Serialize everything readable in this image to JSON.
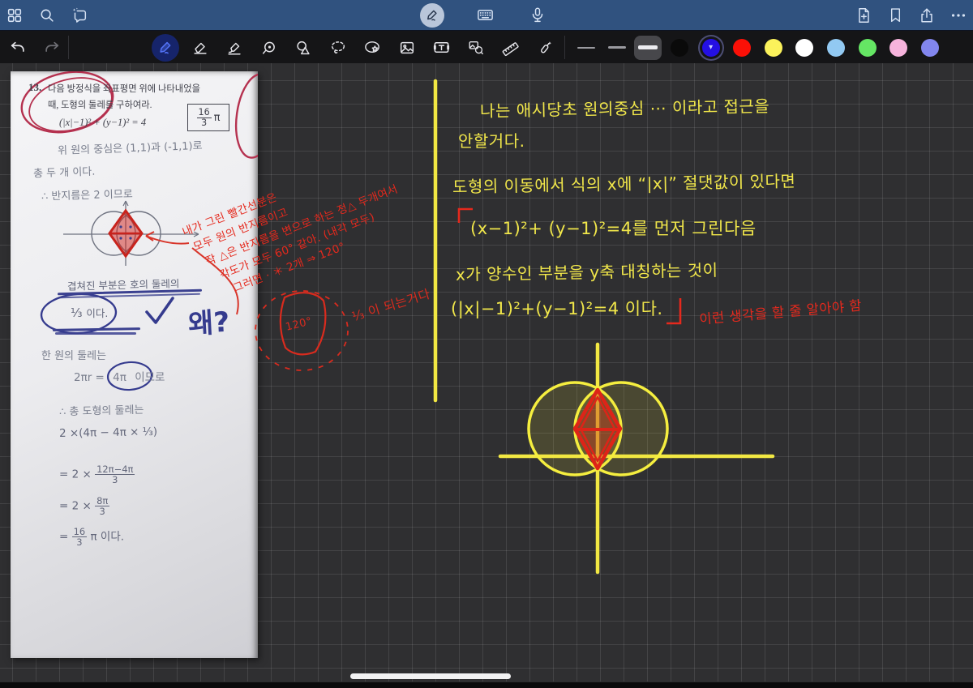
{
  "topbar": {
    "left_icons": [
      "apps-grid",
      "search",
      "sparkle-chat"
    ],
    "center_icons": [
      "pen-mode",
      "keyboard",
      "microphone"
    ],
    "right_icons": [
      "add-page",
      "bookmark",
      "share",
      "more"
    ]
  },
  "toolbar": {
    "tools": [
      "undo",
      "redo",
      "pen",
      "eraser",
      "highlighter",
      "loupe",
      "shapes",
      "lasso",
      "sticker",
      "image",
      "text",
      "photo-search",
      "ruler",
      "laser"
    ],
    "selected_tool": "pen",
    "stroke_widths": [
      "thin",
      "medium",
      "thick"
    ],
    "selected_stroke": "thick",
    "colors": [
      {
        "name": "black",
        "hex": "#0a0a0a",
        "css": "background:#0a0a0a"
      },
      {
        "name": "blue",
        "hex": "#2410e3",
        "css": "background:#2410e3",
        "selected": true
      },
      {
        "name": "red",
        "hex": "#fb1007",
        "css": "background:#fb1007"
      },
      {
        "name": "yellow",
        "hex": "#fbf25b",
        "css": "background:#fbf25b"
      },
      {
        "name": "white",
        "hex": "#ffffff",
        "css": "background:#ffffff"
      },
      {
        "name": "sky-blue",
        "hex": "#92c9f2",
        "css": "background:#92c9f2"
      },
      {
        "name": "green",
        "hex": "#65e664",
        "css": "background:#65e664"
      },
      {
        "name": "pink",
        "hex": "#f6b3dc",
        "css": "background:#f6b3dc"
      },
      {
        "name": "periwinkle",
        "hex": "#8286ee",
        "css": "background:#8286ee"
      }
    ]
  },
  "paper": {
    "problem_number": "13.",
    "problem_line1": "다음 방정식을 좌표평면 위에 나타내었을",
    "problem_line2": "때, 도형의 둘레를 구하여라.",
    "formula": "(|x|−1)² + (y−1)² = 4",
    "answer_numerator": "16",
    "answer_denominator": "3",
    "answer_pi": "π",
    "pencil_line1": "위 원의 중심은 (1,1)과 (-1,1)로",
    "pencil_line2": "총 두 개 이다.",
    "pencil_line3": "∴ 반지름은 2 이므로",
    "covered_line": "겹쳐진 부분은 호의 둘레의",
    "third_label": "⅓",
    "third_suffix": "이다.",
    "why_question": "왜?",
    "circumference_line": "한 원의 둘레는",
    "circ_prefix": "2πr =",
    "circ_circled": "4π",
    "circ_suffix": "이므로",
    "total_line": "∴ 총 도형의 둘레는",
    "calc_line1": "2 ×(4π − 4π × ⅓)",
    "calc2_prefix": "= 2 ×",
    "calc2_num": "12π−4π",
    "calc2_den": "3",
    "calc3_prefix": "= 2 ×",
    "calc3_num": "8π",
    "calc3_den": "3",
    "calc4_prefix": "=",
    "calc4_num": "16",
    "calc4_den": "3",
    "calc4_suffix": "π  이다."
  },
  "red_note": {
    "line1": "내가 그린 빨간선분은",
    "line2": "모두 원의 반지름이고",
    "line3": "작 △은 반지름을 변으로 하는 정△ 두개여서",
    "line4": "각도가 모두 60° 같아. (내각 모두)",
    "line5": "그러면  · ＊ 2개 ⇒ 120°",
    "sector_angle": "120°",
    "sector_note": "⅓ 이 되는거다"
  },
  "notes": {
    "yellow1": "나는 애시당초 원의중심 ⋯ 이라고 접근을",
    "yellow2": "안할거다.",
    "yellow3": "도형의 이동에서 식의 x에 “|x|” 절댓값이 있다면",
    "yellow4": "(x−1)²+ (y−1)²=4를 먼저 그린다음",
    "yellow5": "x가 양수인 부분을 y축 대칭하는 것이",
    "yellow6": "(|x|−1)²+(y−1)²=4  이다.",
    "red_inline": "이런 생각을 할 줄 알아야 함"
  }
}
